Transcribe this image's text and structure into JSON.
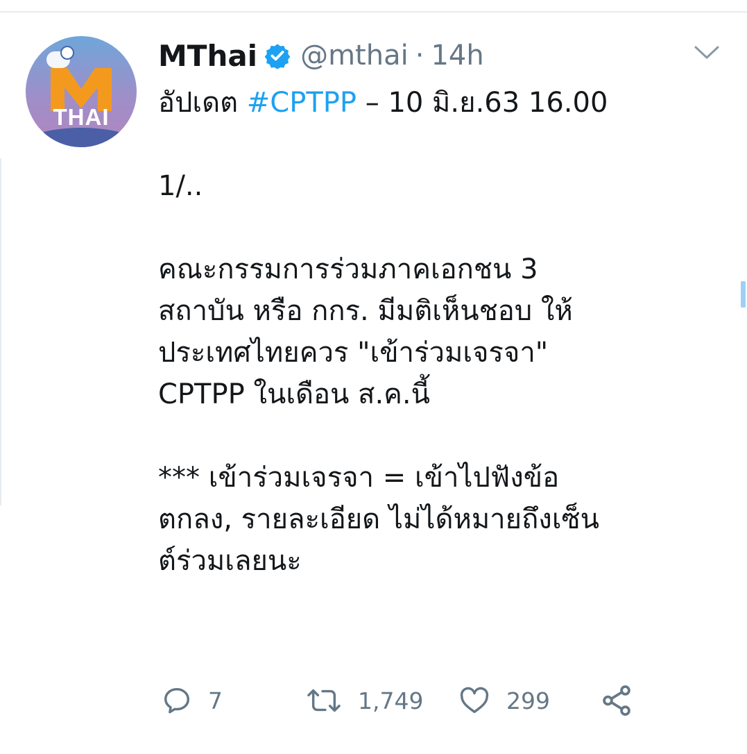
{
  "tweet": {
    "display_name": "MThai",
    "handle": "@mthai",
    "separator": "·",
    "timestamp": "14h",
    "avatar_text": "THAI",
    "lines": {
      "l1_prefix": "อัปเดต ",
      "l1_hashtag": "#CPTPP",
      "l1_suffix": " – 10 มิ.ย.63 16.00",
      "l2": "1/..",
      "l3": "คณะกรรมการร่วมภาคเอกชน 3",
      "l4": "สถาบัน หรือ กกร. มีมติเห็นชอบ ให้",
      "l5": "ประเทศไทยควร \"เข้าร่วมเจรจา\"",
      "l6": "CPTPP ในเดือน ส.ค.นี้",
      "l7": "*** เข้าร่วมเจรจา = เข้าไปฟังข้อ",
      "l8": "ตกลง, รายละเอียด ไม่ได้หมายถึงเซ็น",
      "l9": "ต์ร่วมเลยนะ"
    }
  },
  "actions": {
    "reply_count": "7",
    "retweet_count": "1,749",
    "like_count": "299"
  },
  "colors": {
    "accent": "#1da1f2",
    "muted": "#657786",
    "text": "#14171a",
    "logo_orange": "#f39a1e"
  },
  "icons": [
    "verified-badge-icon",
    "chevron-down-icon",
    "reply-icon",
    "retweet-icon",
    "like-icon",
    "share-icon"
  ]
}
